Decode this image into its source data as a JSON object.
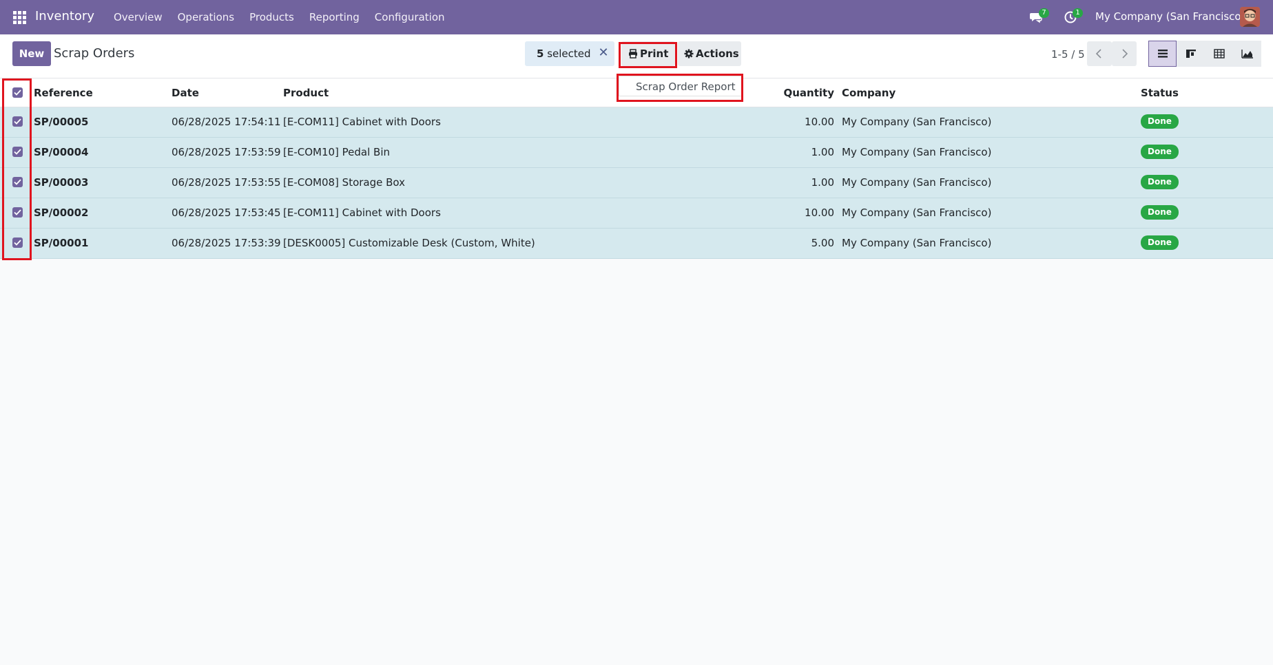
{
  "navbar": {
    "app_name": "Inventory",
    "menu": [
      "Overview",
      "Operations",
      "Products",
      "Reporting",
      "Configuration"
    ],
    "messages_count": "7",
    "activities_count": "1",
    "company": "My Company (San Francisco)"
  },
  "control": {
    "new_label": "New",
    "title": "Scrap Orders",
    "selected_count": "5",
    "selected_label": "selected",
    "print_label": "Print",
    "actions_label": "Actions",
    "pager": "1-5 / 5"
  },
  "print_dropdown": {
    "items": [
      "Scrap Order Report"
    ]
  },
  "table": {
    "columns": [
      "Reference",
      "Date",
      "Product",
      "Quantity",
      "Company",
      "Status"
    ],
    "rows": [
      {
        "reference": "SP/00005",
        "date": "06/28/2025 17:54:11",
        "product": "[E-COM11] Cabinet with Doors",
        "quantity": "10.00",
        "company": "My Company (San Francisco)",
        "status": "Done"
      },
      {
        "reference": "SP/00004",
        "date": "06/28/2025 17:53:59",
        "product": "[E-COM10] Pedal Bin",
        "quantity": "1.00",
        "company": "My Company (San Francisco)",
        "status": "Done"
      },
      {
        "reference": "SP/00003",
        "date": "06/28/2025 17:53:55",
        "product": "[E-COM08] Storage Box",
        "quantity": "1.00",
        "company": "My Company (San Francisco)",
        "status": "Done"
      },
      {
        "reference": "SP/00002",
        "date": "06/28/2025 17:53:45",
        "product": "[E-COM11] Cabinet with Doors",
        "quantity": "10.00",
        "company": "My Company (San Francisco)",
        "status": "Done"
      },
      {
        "reference": "SP/00001",
        "date": "06/28/2025 17:53:39",
        "product": "[DESK0005] Customizable Desk (Custom, White)",
        "quantity": "5.00",
        "company": "My Company (San Francisco)",
        "status": "Done"
      }
    ]
  },
  "colors": {
    "brand": "#71639e",
    "row_selected": "#d5e9ee",
    "status_done": "#28a745",
    "highlight": "#e0141e"
  },
  "icons": [
    "apps-grid-icon",
    "chat-icon",
    "clock-icon",
    "print-icon",
    "gear-icon",
    "close-icon",
    "chevron-left-icon",
    "chevron-right-icon",
    "list-view-icon",
    "kanban-view-icon",
    "pivot-view-icon",
    "graph-view-icon",
    "checkbox-checked-icon"
  ]
}
